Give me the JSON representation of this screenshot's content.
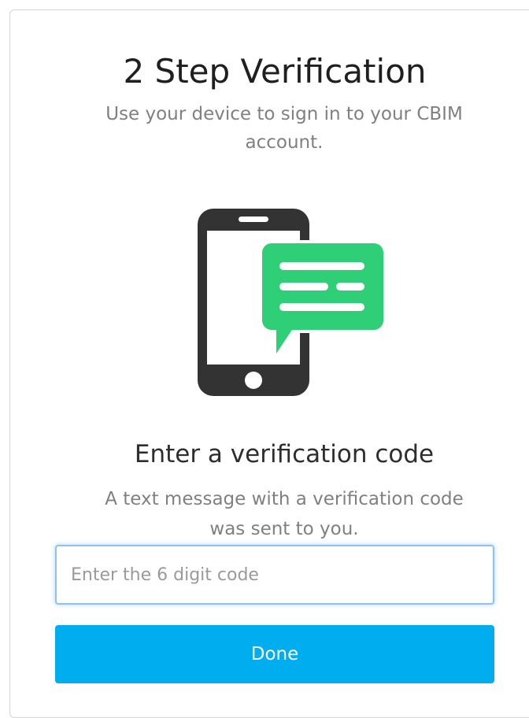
{
  "page": {
    "title": "2 Step Verification",
    "subtitle": "Use your device to sign in to your CBIM account."
  },
  "illustration": {
    "icon": "phone-sms-icon",
    "phone_color": "#333333",
    "bubble_color": "#2fcf78"
  },
  "verification": {
    "heading": "Enter a verification code",
    "description": "A text message with a verification code was sent to you.",
    "code_input": {
      "value": "",
      "placeholder": "Enter the 6 digit code"
    },
    "done_label": "Done",
    "button_color": "#00adef"
  }
}
